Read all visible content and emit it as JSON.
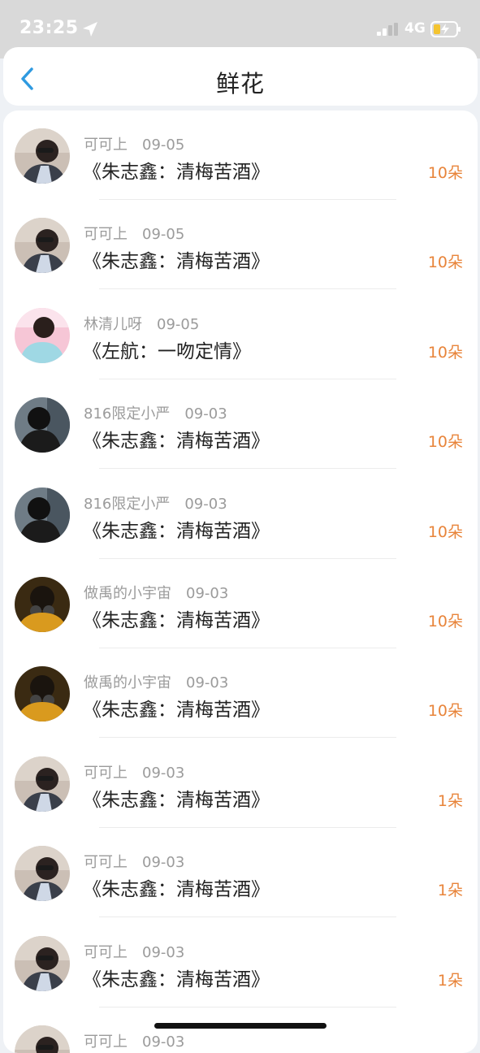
{
  "status_bar": {
    "time": "23:25",
    "network": "4G"
  },
  "nav": {
    "title": "鲜花"
  },
  "colors": {
    "accent_blue": "#2f9ae0",
    "quantity_orange": "#e8843a",
    "meta_gray": "#9b9b9b"
  },
  "gifts": [
    {
      "user": "可可上",
      "date": "09-05",
      "book": "《朱志鑫：清梅苦酒》",
      "quantity": "10朵",
      "avatar": "avatar-a"
    },
    {
      "user": "可可上",
      "date": "09-05",
      "book": "《朱志鑫：清梅苦酒》",
      "quantity": "10朵",
      "avatar": "avatar-a"
    },
    {
      "user": "林清儿呀",
      "date": "09-05",
      "book": "《左航：一吻定情》",
      "quantity": "10朵",
      "avatar": "avatar-b"
    },
    {
      "user": "816限定小严",
      "date": "09-03",
      "book": "《朱志鑫：清梅苦酒》",
      "quantity": "10朵",
      "avatar": "avatar-c"
    },
    {
      "user": "816限定小严",
      "date": "09-03",
      "book": "《朱志鑫：清梅苦酒》",
      "quantity": "10朵",
      "avatar": "avatar-c"
    },
    {
      "user": "做禹的小宇宙",
      "date": "09-03",
      "book": "《朱志鑫：清梅苦酒》",
      "quantity": "10朵",
      "avatar": "avatar-d"
    },
    {
      "user": "做禹的小宇宙",
      "date": "09-03",
      "book": "《朱志鑫：清梅苦酒》",
      "quantity": "10朵",
      "avatar": "avatar-d"
    },
    {
      "user": "可可上",
      "date": "09-03",
      "book": "《朱志鑫：清梅苦酒》",
      "quantity": "1朵",
      "avatar": "avatar-a"
    },
    {
      "user": "可可上",
      "date": "09-03",
      "book": "《朱志鑫：清梅苦酒》",
      "quantity": "1朵",
      "avatar": "avatar-a"
    },
    {
      "user": "可可上",
      "date": "09-03",
      "book": "《朱志鑫：清梅苦酒》",
      "quantity": "1朵",
      "avatar": "avatar-a"
    },
    {
      "user": "可可上",
      "date": "09-03",
      "book": "",
      "quantity": "",
      "avatar": "avatar-a"
    }
  ]
}
